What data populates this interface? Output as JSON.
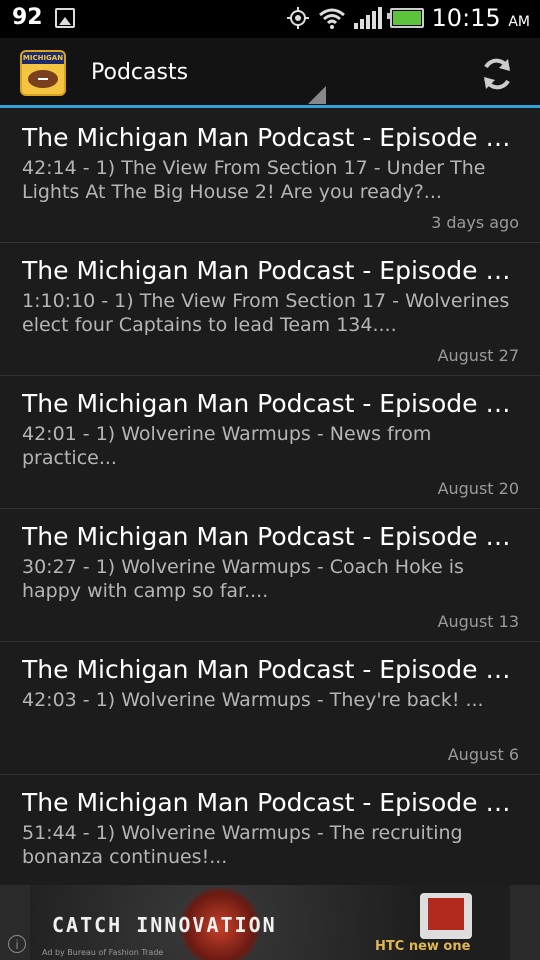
{
  "status_bar": {
    "notification_count": "92",
    "time": "10:15",
    "ampm": "AM",
    "icons": [
      "image-icon",
      "gps-icon",
      "wifi-icon",
      "signal-icon",
      "battery-icon"
    ]
  },
  "action_bar": {
    "app_icon_text": "MICHIGAN",
    "title": "Podcasts",
    "accent_color": "#33a0d6"
  },
  "episodes": [
    {
      "title": "The Michigan Man Podcast - Episode 1...",
      "desc": "42:14 - 1) The View From Section 17 - Under The Lights At The Big House 2! Are you ready?...",
      "date": "3 days ago"
    },
    {
      "title": "The Michigan Man Podcast - Episode 1...",
      "desc": "1:10:10 - 1) The View From Section 17 - Wolverines elect four Captains to lead Team 134....",
      "date": "August 27"
    },
    {
      "title": "The Michigan Man Podcast - Episode 1...",
      "desc": "42:01 - 1) Wolverine Warmups - News from practice...",
      "date": "August 20"
    },
    {
      "title": "The Michigan Man Podcast - Episode 1...",
      "desc": "30:27 - 1) Wolverine Warmups - Coach Hoke is happy with camp so far....",
      "date": "August 13"
    },
    {
      "title": "The Michigan Man Podcast - Episode 1...",
      "desc": "42:03 - 1) Wolverine Warmups - They're back! ...",
      "date": "August 6"
    },
    {
      "title": "The Michigan Man Podcast - Episode 1...",
      "desc": "51:44 - 1) Wolverine Warmups - The recruiting bonanza continues!...",
      "date": ""
    }
  ],
  "ad": {
    "headline": "CATCH INNOVATION",
    "sub": "HTC new one",
    "credit": "Ad by Bureau of Fashion Trade"
  }
}
